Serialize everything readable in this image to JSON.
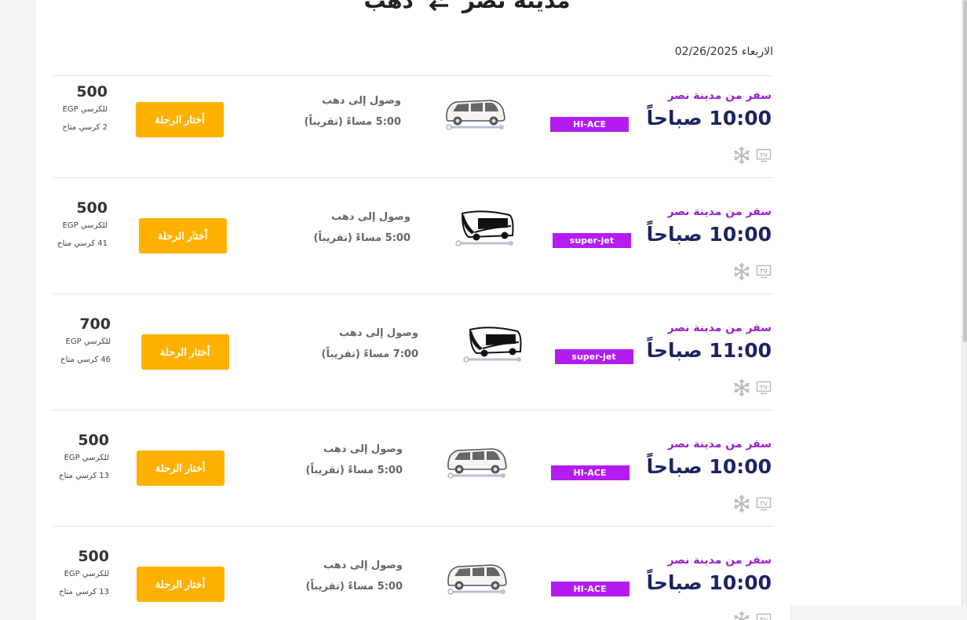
{
  "route": {
    "from": "مدينة نصر",
    "to": "دهب"
  },
  "date": {
    "day": "الاربعاء",
    "value": "02/26/2025"
  },
  "trips": [
    {
      "depart_label": "سفر من مدينة نصر",
      "depart_time": "10:00 صباحاً",
      "badge": "HI-ACE",
      "vehicle": "minivan",
      "arrive_label": "وصول إلى دهب",
      "arrive_time": "5:00 مساءً (تقريباً)",
      "button": "أختار الرحلة",
      "price": "500",
      "per_seat": "EGP للكرسي",
      "seats": "2 كرسي متاح"
    },
    {
      "depart_label": "سفر من مدينة نصر",
      "depart_time": "10:00 صباحاً",
      "badge": "super-jet",
      "vehicle": "bus",
      "arrive_label": "وصول إلى دهب",
      "arrive_time": "5:00 مساءً (تقريباً)",
      "button": "أختار الرحلة",
      "price": "500",
      "per_seat": "EGP للكرسي",
      "seats": "41 كرسي متاح"
    },
    {
      "depart_label": "سفر من مدينة نصر",
      "depart_time": "11:00 صباحاً",
      "badge": "super-jet",
      "vehicle": "bus",
      "arrive_label": "وصول إلى دهب",
      "arrive_time": "7:00 مساءً (تقريباً)",
      "button": "أختار الرحلة",
      "price": "700",
      "per_seat": "EGP للكرسي",
      "seats": "46 كرسي متاح"
    },
    {
      "depart_label": "سفر من مدينة نصر",
      "depart_time": "10:00 صباحاً",
      "badge": "HI-ACE",
      "vehicle": "minivan",
      "arrive_label": "وصول إلى دهب",
      "arrive_time": "5:00 مساءً (تقريباً)",
      "button": "أختار الرحلة",
      "price": "500",
      "per_seat": "EGP للكرسي",
      "seats": "13 كرسي متاح"
    },
    {
      "depart_label": "سفر من مدينة نصر",
      "depart_time": "10:00 صباحاً",
      "badge": "HI-ACE",
      "vehicle": "minivan",
      "arrive_label": "وصول إلى دهب",
      "arrive_time": "5:00 مساءً (تقريباً)",
      "button": "أختار الرحلة",
      "price": "500",
      "per_seat": "EGP للكرسي",
      "seats": "13 كرسي متاح"
    }
  ],
  "amenity_icons": [
    "tv-icon",
    "snowflake-icon"
  ],
  "colors": {
    "purple": "#9b1fd1",
    "badge": "#b51cf1",
    "navy": "#1b2461",
    "orange": "#ffb100"
  }
}
